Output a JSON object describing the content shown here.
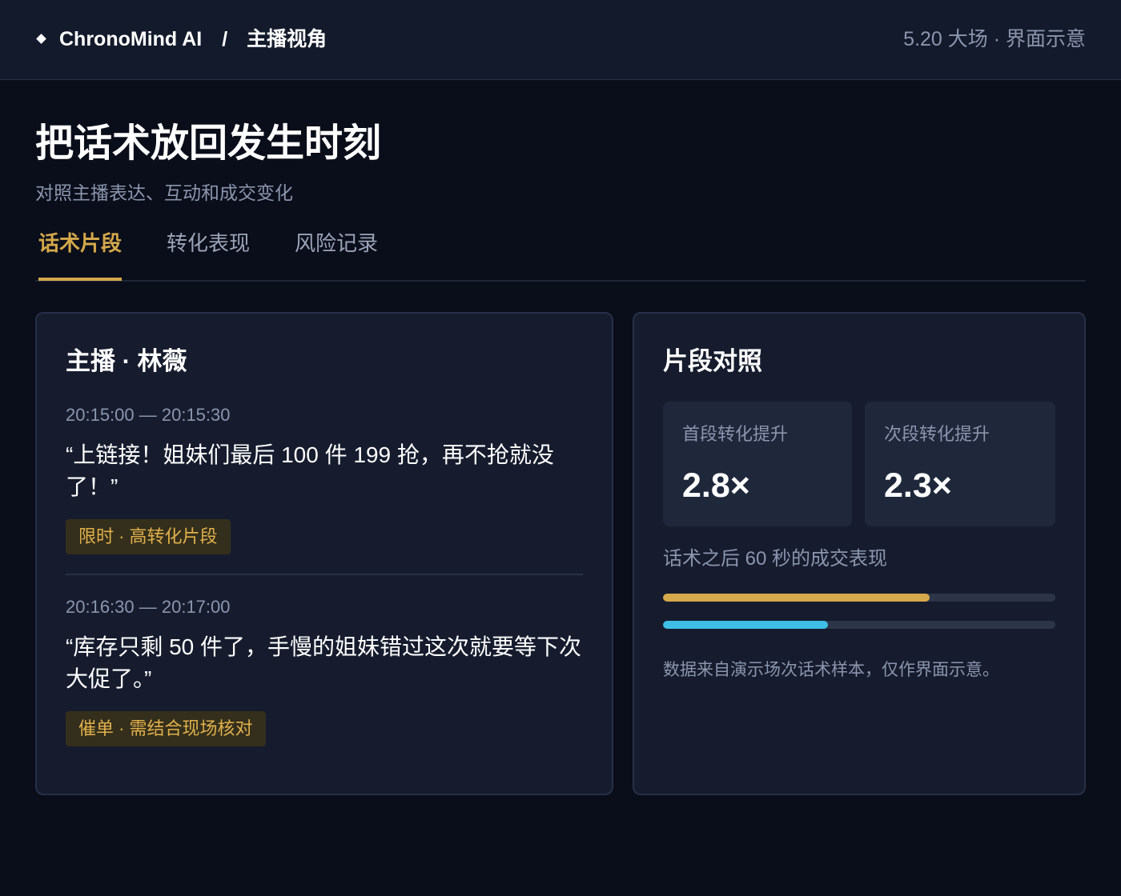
{
  "header": {
    "brand": "ChronoMind AI",
    "separator": "/",
    "section": "主播视角",
    "session_info": "5.20 大场 · 界面示意"
  },
  "page": {
    "title": "把话术放回发生时刻",
    "subtitle": "对照主播表达、互动和成交变化"
  },
  "tabs": [
    {
      "label": "话术片段",
      "active": true
    },
    {
      "label": "转化表现",
      "active": false
    },
    {
      "label": "风险记录",
      "active": false
    }
  ],
  "host_card": {
    "title": "主播 · 林薇",
    "segments": [
      {
        "time": "20:15:00 — 20:15:30",
        "quote": "“上链接！姐妹们最后 100 件 199 抢，再不抢就没了！”",
        "tag": "限时 · 高转化片段"
      },
      {
        "time": "20:16:30 — 20:17:00",
        "quote": "“库存只剩 50 件了，手慢的姐妹错过这次就要等下次大促了。”",
        "tag": "催单 · 需结合现场核对"
      }
    ]
  },
  "compare_card": {
    "title": "片段对照",
    "stats": [
      {
        "label": "首段转化提升",
        "value": "2.8×"
      },
      {
        "label": "次段转化提升",
        "value": "2.3×"
      }
    ],
    "bars_caption": "话术之后 60 秒的成交表现",
    "bars": [
      {
        "fraction": 0.68,
        "color": "#d4a84b"
      },
      {
        "fraction": 0.42,
        "color": "#3fbfe6"
      }
    ],
    "footnote": "数据来自演示场次话术样本，仅作界面示意。"
  }
}
